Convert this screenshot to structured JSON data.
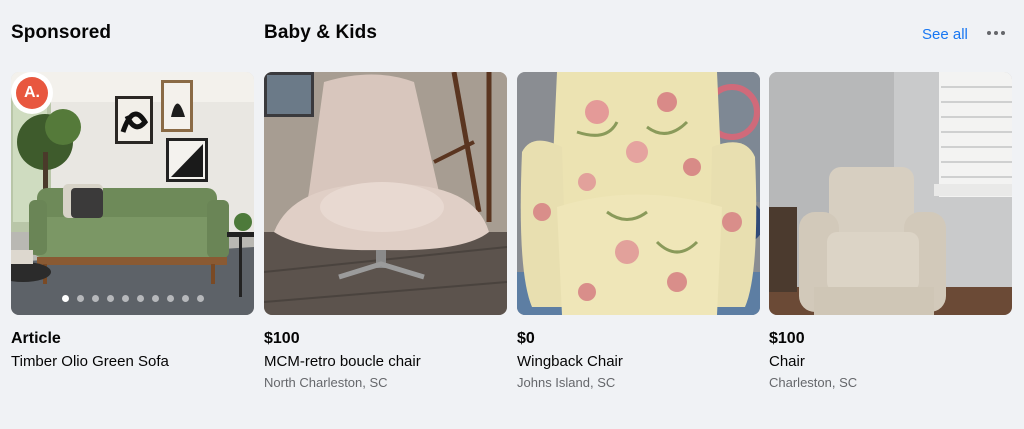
{
  "sponsored": {
    "title": "Sponsored",
    "brand_initial": "A.",
    "advertiser": "Article",
    "product": "Timber Olio Green Sofa",
    "carousel_dots": 10,
    "active_dot": 1
  },
  "category": {
    "title": "Baby & Kids",
    "see_all": "See all",
    "more_icon": "more-horizontal-icon"
  },
  "listings": [
    {
      "price": "$100",
      "title": "MCM-retro boucle chair",
      "location": "North Charleston, SC"
    },
    {
      "price": "$0",
      "title": "Wingback Chair",
      "location": "Johns Island, SC"
    },
    {
      "price": "$100",
      "title": "Chair",
      "location": "Charleston, SC"
    }
  ],
  "colors": {
    "link": "#1877f2",
    "brand": "#e8573f",
    "background": "#f0f2f5"
  }
}
